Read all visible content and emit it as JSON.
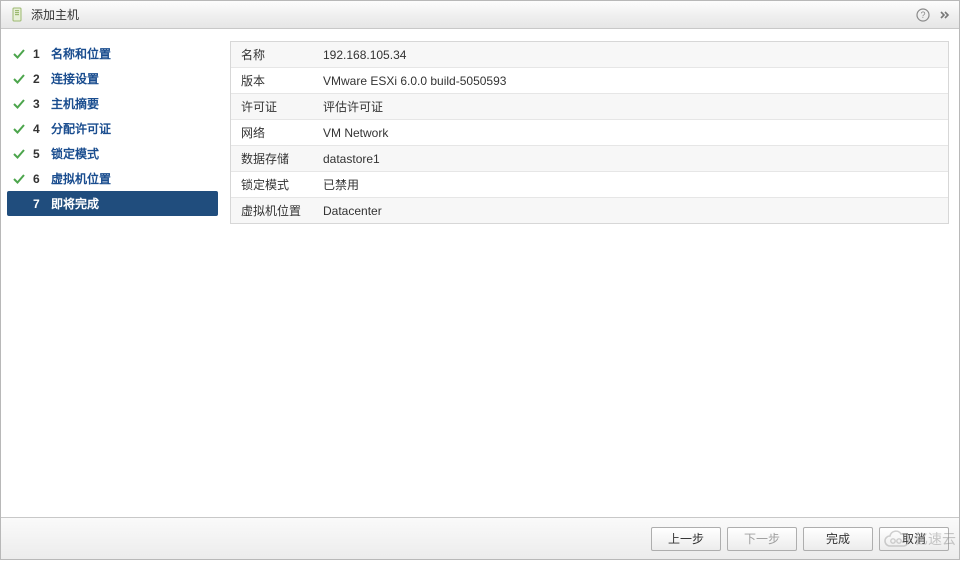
{
  "titlebar": {
    "title": "添加主机"
  },
  "steps": [
    {
      "num": "1",
      "label": "名称和位置",
      "done": true,
      "active": false
    },
    {
      "num": "2",
      "label": "连接设置",
      "done": true,
      "active": false
    },
    {
      "num": "3",
      "label": "主机摘要",
      "done": true,
      "active": false
    },
    {
      "num": "4",
      "label": "分配许可证",
      "done": true,
      "active": false
    },
    {
      "num": "5",
      "label": "锁定模式",
      "done": true,
      "active": false
    },
    {
      "num": "6",
      "label": "虚拟机位置",
      "done": true,
      "active": false
    },
    {
      "num": "7",
      "label": "即将完成",
      "done": false,
      "active": true
    }
  ],
  "summary": {
    "rows": [
      {
        "key": "名称",
        "val": "192.168.105.34"
      },
      {
        "key": "版本",
        "val": "VMware ESXi 6.0.0 build-5050593"
      },
      {
        "key": "许可证",
        "val": "评估许可证"
      },
      {
        "key": "网络",
        "val": "VM Network"
      },
      {
        "key": "数据存储",
        "val": "datastore1"
      },
      {
        "key": "锁定模式",
        "val": "已禁用"
      },
      {
        "key": "虚拟机位置",
        "val": "Datacenter"
      }
    ]
  },
  "footer": {
    "back": "上一步",
    "next": "下一步",
    "finish": "完成",
    "cancel": "取消"
  },
  "watermark": {
    "text": "亿速云"
  }
}
